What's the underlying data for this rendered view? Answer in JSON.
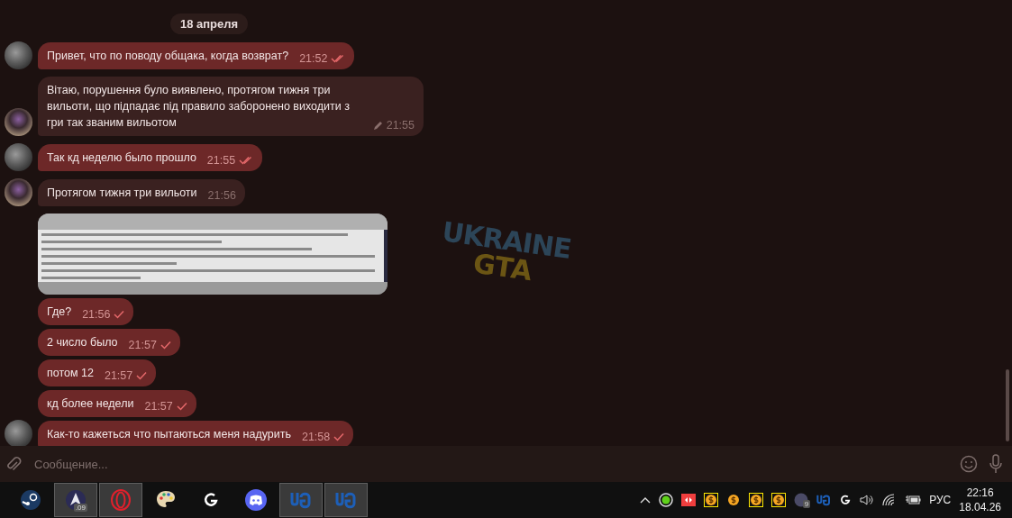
{
  "chat": {
    "date_label": "18 апреля",
    "messages": [
      {
        "kind": "text",
        "outgoing": true,
        "text": "Привет, что по поводу общака, когда возврат?",
        "time": "21:52",
        "delivered": true,
        "read": true,
        "edited": false,
        "avatar": true
      },
      {
        "kind": "text",
        "outgoing": false,
        "text": "Вітаю, порушення було виявлено, протягом тижня три вильоти, що підпадає під правило заборонено виходити з гри так званим вильотом",
        "time": "21:55",
        "delivered": false,
        "read": false,
        "edited": true,
        "avatar": true
      },
      {
        "kind": "text",
        "outgoing": true,
        "text": "Так кд неделю было прошло",
        "time": "21:55",
        "delivered": true,
        "read": true,
        "edited": false,
        "avatar": true
      },
      {
        "kind": "text",
        "outgoing": false,
        "text": "Протягом тижня три вильоти",
        "time": "21:56",
        "delivered": false,
        "read": false,
        "edited": false,
        "avatar": true
      },
      {
        "kind": "picture"
      },
      {
        "kind": "text",
        "outgoing": true,
        "text": "Где?",
        "time": "21:56",
        "delivered": true,
        "read": false,
        "edited": false,
        "avatar": false
      },
      {
        "kind": "text",
        "outgoing": true,
        "text": "2 число было",
        "time": "21:57",
        "delivered": true,
        "read": false,
        "edited": false,
        "avatar": false
      },
      {
        "kind": "text",
        "outgoing": true,
        "text": "потом 12",
        "time": "21:57",
        "delivered": true,
        "read": false,
        "edited": false,
        "avatar": false
      },
      {
        "kind": "text",
        "outgoing": true,
        "text": "кд более недели",
        "time": "21:57",
        "delivered": true,
        "read": false,
        "edited": false,
        "avatar": false
      },
      {
        "kind": "text",
        "outgoing": true,
        "text": "Как-то кажеться что пытаються меня надурить",
        "time": "21:58",
        "delivered": true,
        "read": false,
        "edited": false,
        "avatar": true
      }
    ],
    "wallpaper_logo": {
      "line_1": "UKRAINE",
      "line_2": "GTA"
    }
  },
  "composer": {
    "placeholder": "Сообщение..."
  },
  "taskbar": {
    "apps": [
      {
        "kind": "steam",
        "active": false
      },
      {
        "kind": "arrow",
        "active": true,
        "badge": ".09"
      },
      {
        "kind": "opera",
        "active": true
      },
      {
        "kind": "palette",
        "active": false
      },
      {
        "kind": "logi",
        "active": false
      },
      {
        "kind": "discord",
        "active": false
      },
      {
        "kind": "ug",
        "active": true
      },
      {
        "kind": "ug",
        "active": true
      }
    ],
    "tray": [
      {
        "kind": "chevron"
      },
      {
        "kind": "green"
      },
      {
        "kind": "red"
      },
      {
        "kind": "coin",
        "boxed": true
      },
      {
        "kind": "coin",
        "boxed": false
      },
      {
        "kind": "coin",
        "boxed": true
      },
      {
        "kind": "coin",
        "boxed": true
      },
      {
        "kind": "badge",
        "badge": "9"
      },
      {
        "kind": "ug"
      },
      {
        "kind": "logi"
      },
      {
        "kind": "volume"
      },
      {
        "kind": "wifi"
      },
      {
        "kind": "battery"
      }
    ],
    "language": "РУС",
    "time": "22:16",
    "date": "18.04.26"
  }
}
